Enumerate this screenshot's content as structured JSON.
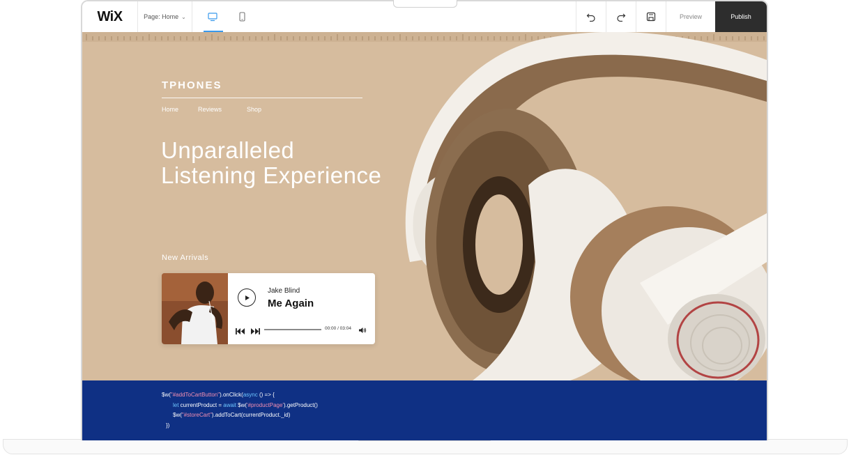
{
  "toolbar": {
    "logo": "WiX",
    "page_selector": "Page: Home",
    "preview_label": "Preview",
    "publish_label": "Publish"
  },
  "site": {
    "brand": "TPHONES",
    "nav": [
      "Home",
      "Reviews",
      "Shop"
    ],
    "hero_line1": "Unparalleled",
    "hero_line2": "Listening Experience",
    "section_label": "New Arrivals"
  },
  "player": {
    "artist": "Jake Blind",
    "song": "Me Again",
    "time": "00:00 / 03:04",
    "progress": 0
  },
  "code": {
    "l1_a": "$w(",
    "l1_b": "\"#addToCartButton\"",
    "l1_c": ").onClick(",
    "l1_d": "async",
    "l1_e": " () => {",
    "l2_a": "let",
    "l2_b": " currentProduct = ",
    "l2_c": "await",
    "l2_d": " $w(",
    "l2_e": "'#productPage'",
    "l2_f": ").getProduct()",
    "l3_a": "$w(",
    "l3_b": "\"#storeCart\"",
    "l3_c": ").addToCart(currentProduct._id)",
    "l4": "})"
  },
  "colors": {
    "canvas_bg": "#d6bc9e",
    "code_bg": "#0f3084",
    "publish_bg": "#2d2d2d",
    "active_device": "#3899ec"
  },
  "icons": [
    "desktop-icon",
    "mobile-icon",
    "undo-icon",
    "redo-icon",
    "save-icon",
    "play-icon",
    "previous-icon",
    "next-icon",
    "volume-icon"
  ]
}
